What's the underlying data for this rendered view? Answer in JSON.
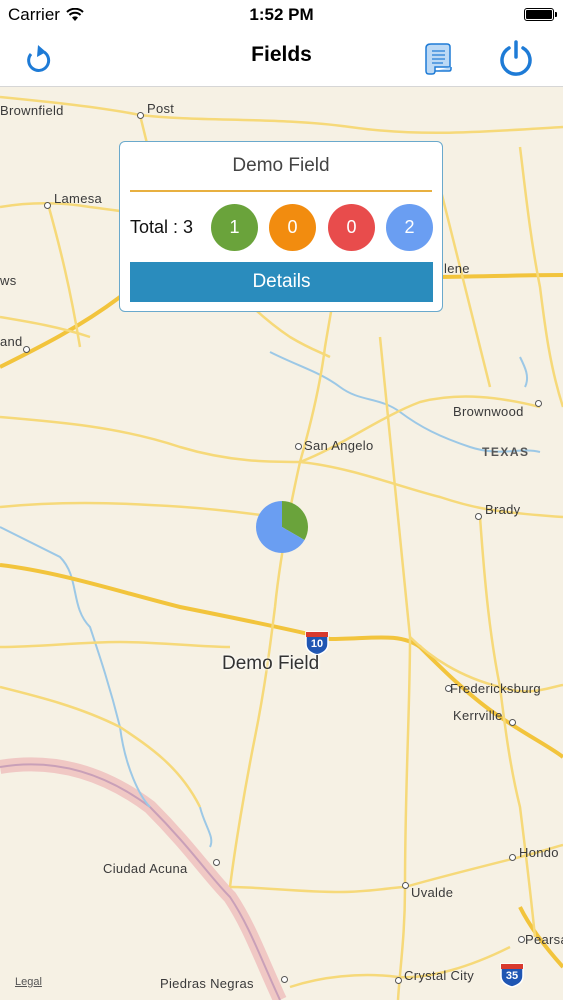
{
  "status_bar": {
    "carrier": "Carrier",
    "time": "1:52 PM"
  },
  "nav": {
    "title": "Fields",
    "left_icon": "refresh-icon",
    "scroll_icon": "scroll-icon",
    "power_icon": "power-icon"
  },
  "callout": {
    "title": "Demo Field",
    "total_label": "Total : 3",
    "counts": [
      {
        "value": "1",
        "color": "#6aa33b"
      },
      {
        "value": "0",
        "color": "#f28c0f"
      },
      {
        "value": "0",
        "color": "#e84c4c"
      },
      {
        "value": "2",
        "color": "#6a9ef2"
      }
    ],
    "details_label": "Details"
  },
  "marker": {
    "label": "Demo Field",
    "slices": [
      {
        "value": 1,
        "color": "#6aa33b"
      },
      {
        "value": 2,
        "color": "#6a9ef2"
      }
    ]
  },
  "map": {
    "cities": {
      "brownfield": "Brownfield",
      "post": "Post",
      "lamesa": "Lamesa",
      "ws": "ws",
      "and": "and",
      "abilene": "lene",
      "brownwood": "Brownwood",
      "texas": "TEXAS",
      "san_angelo": "San Angelo",
      "brady": "Brady",
      "fredericksburg": "Fredericksburg",
      "kerrville": "Kerrville",
      "ciudad_acuna": "Ciudad Acuna",
      "hondo": "Hondo",
      "uvalde": "Uvalde",
      "pearsall": "Pearsa",
      "piedras_negras": "Piedras Negras",
      "crystal_city": "Crystal City"
    },
    "shields": {
      "i10": "10",
      "i35": "35"
    },
    "legal": "Legal"
  }
}
